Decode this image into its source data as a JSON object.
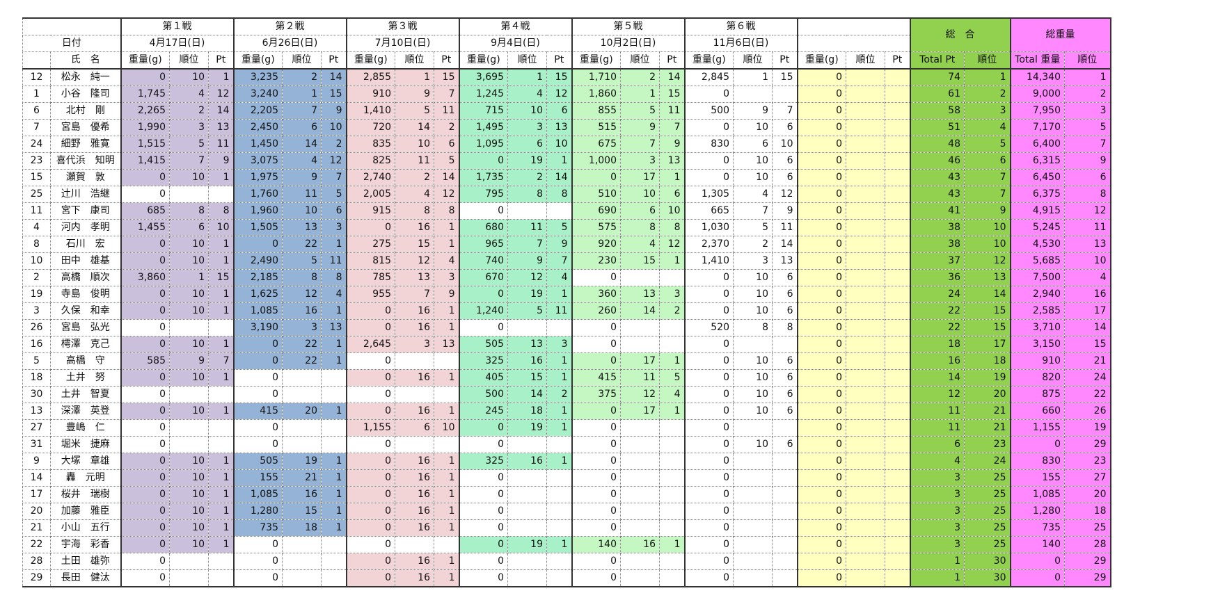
{
  "header": {
    "date_label": "日付",
    "name_label": "氏　名",
    "rounds": [
      {
        "title": "第１戦",
        "date": "4月17日(日)"
      },
      {
        "title": "第２戦",
        "date": "6月26日(日)"
      },
      {
        "title": "第３戦",
        "date": "7月10日(日)"
      },
      {
        "title": "第４戦",
        "date": "9月4日(日)"
      },
      {
        "title": "第５戦",
        "date": "10月2日(日)"
      },
      {
        "title": "第６戦",
        "date": "11月6日(日)"
      },
      {
        "title": "",
        "date": ""
      }
    ],
    "sub": {
      "weight": "重量(g)",
      "rank": "順位",
      "pt": "Pt"
    },
    "total": {
      "title": "総　合",
      "pt": "Total Pt",
      "rank": "順位"
    },
    "weight_total": {
      "title": "総重量",
      "weight": "Total 重量",
      "rank": "順位"
    }
  },
  "colors": {
    "round1": "#cbc0dc",
    "round2": "#95b3d6",
    "round3": "#f3d4d6",
    "round4": "#a8f0c8",
    "round5": "#c4f7c2",
    "round7": "#ffffc0",
    "total": "#92d050",
    "weight_total": "#ff88ff"
  },
  "rows": [
    {
      "no": "12",
      "name": "松永　純一",
      "r": [
        [
          "0",
          "10",
          "1"
        ],
        [
          "3,235",
          "2",
          "14"
        ],
        [
          "2,855",
          "1",
          "15"
        ],
        [
          "3,695",
          "1",
          "15"
        ],
        [
          "1,710",
          "2",
          "14"
        ],
        [
          "2,845",
          "1",
          "15"
        ],
        [
          "0",
          "",
          ""
        ]
      ],
      "pt": "74",
      "rank": "1",
      "w": "14,340",
      "wr": "1"
    },
    {
      "no": "1",
      "name": "小谷　隆司",
      "r": [
        [
          "1,745",
          "4",
          "12"
        ],
        [
          "3,240",
          "1",
          "15"
        ],
        [
          "910",
          "9",
          "7"
        ],
        [
          "1,245",
          "4",
          "12"
        ],
        [
          "1,860",
          "1",
          "15"
        ],
        [
          "0",
          "",
          ""
        ],
        [
          "0",
          "",
          ""
        ]
      ],
      "pt": "61",
      "rank": "2",
      "w": "9,000",
      "wr": "2"
    },
    {
      "no": "6",
      "name": "北村　剛",
      "r": [
        [
          "2,265",
          "2",
          "14"
        ],
        [
          "2,205",
          "7",
          "9"
        ],
        [
          "1,410",
          "5",
          "11"
        ],
        [
          "715",
          "10",
          "6"
        ],
        [
          "855",
          "5",
          "11"
        ],
        [
          "500",
          "9",
          "7"
        ],
        [
          "0",
          "",
          ""
        ]
      ],
      "pt": "58",
      "rank": "3",
      "w": "7,950",
      "wr": "3"
    },
    {
      "no": "7",
      "name": "宮島　優希",
      "r": [
        [
          "1,990",
          "3",
          "13"
        ],
        [
          "2,450",
          "6",
          "10"
        ],
        [
          "720",
          "14",
          "2"
        ],
        [
          "1,495",
          "3",
          "13"
        ],
        [
          "515",
          "9",
          "7"
        ],
        [
          "0",
          "10",
          "6"
        ],
        [
          "0",
          "",
          ""
        ]
      ],
      "pt": "51",
      "rank": "4",
      "w": "7,170",
      "wr": "5"
    },
    {
      "no": "24",
      "name": "細野　雅寛",
      "r": [
        [
          "1,515",
          "5",
          "11"
        ],
        [
          "1,450",
          "14",
          "2"
        ],
        [
          "835",
          "10",
          "6"
        ],
        [
          "1,095",
          "6",
          "10"
        ],
        [
          "675",
          "7",
          "9"
        ],
        [
          "830",
          "6",
          "10"
        ],
        [
          "0",
          "",
          ""
        ]
      ],
      "pt": "48",
      "rank": "5",
      "w": "6,400",
      "wr": "7"
    },
    {
      "no": "23",
      "name": "喜代浜　知明",
      "r": [
        [
          "1,415",
          "7",
          "9"
        ],
        [
          "3,075",
          "4",
          "12"
        ],
        [
          "825",
          "11",
          "5"
        ],
        [
          "0",
          "19",
          "1"
        ],
        [
          "1,000",
          "3",
          "13"
        ],
        [
          "0",
          "10",
          "6"
        ],
        [
          "0",
          "",
          ""
        ]
      ],
      "pt": "46",
      "rank": "6",
      "w": "6,315",
      "wr": "9"
    },
    {
      "no": "15",
      "name": "瀬賀　敦",
      "r": [
        [
          "0",
          "10",
          "1"
        ],
        [
          "1,975",
          "9",
          "7"
        ],
        [
          "2,740",
          "2",
          "14"
        ],
        [
          "1,735",
          "2",
          "14"
        ],
        [
          "0",
          "17",
          "1"
        ],
        [
          "0",
          "10",
          "6"
        ],
        [
          "0",
          "",
          ""
        ]
      ],
      "pt": "43",
      "rank": "7",
      "w": "6,450",
      "wr": "6"
    },
    {
      "no": "25",
      "name": "辻川　浩継",
      "r": [
        [
          "0",
          "",
          ""
        ],
        [
          "1,760",
          "11",
          "5"
        ],
        [
          "2,005",
          "4",
          "12"
        ],
        [
          "795",
          "8",
          "8"
        ],
        [
          "510",
          "10",
          "6"
        ],
        [
          "1,305",
          "4",
          "12"
        ],
        [
          "0",
          "",
          ""
        ]
      ],
      "pt": "43",
      "rank": "7",
      "w": "6,375",
      "wr": "8"
    },
    {
      "no": "11",
      "name": "宮下　康司",
      "r": [
        [
          "685",
          "8",
          "8"
        ],
        [
          "1,960",
          "10",
          "6"
        ],
        [
          "915",
          "8",
          "8"
        ],
        [
          "0",
          "",
          ""
        ],
        [
          "690",
          "6",
          "10"
        ],
        [
          "665",
          "7",
          "9"
        ],
        [
          "0",
          "",
          ""
        ]
      ],
      "pt": "41",
      "rank": "9",
      "w": "4,915",
      "wr": "12"
    },
    {
      "no": "4",
      "name": "河内　孝明",
      "r": [
        [
          "1,455",
          "6",
          "10"
        ],
        [
          "1,505",
          "13",
          "3"
        ],
        [
          "0",
          "16",
          "1"
        ],
        [
          "680",
          "11",
          "5"
        ],
        [
          "575",
          "8",
          "8"
        ],
        [
          "1,030",
          "5",
          "11"
        ],
        [
          "0",
          "",
          ""
        ]
      ],
      "pt": "38",
      "rank": "10",
      "w": "5,245",
      "wr": "11"
    },
    {
      "no": "8",
      "name": "石川　宏",
      "r": [
        [
          "0",
          "10",
          "1"
        ],
        [
          "0",
          "22",
          "1"
        ],
        [
          "275",
          "15",
          "1"
        ],
        [
          "965",
          "7",
          "9"
        ],
        [
          "920",
          "4",
          "12"
        ],
        [
          "2,370",
          "2",
          "14"
        ],
        [
          "0",
          "",
          ""
        ]
      ],
      "pt": "38",
      "rank": "10",
      "w": "4,530",
      "wr": "13"
    },
    {
      "no": "10",
      "name": "田中　雄基",
      "r": [
        [
          "0",
          "10",
          "1"
        ],
        [
          "2,490",
          "5",
          "11"
        ],
        [
          "815",
          "12",
          "4"
        ],
        [
          "740",
          "9",
          "7"
        ],
        [
          "230",
          "15",
          "1"
        ],
        [
          "1,410",
          "3",
          "13"
        ],
        [
          "0",
          "",
          ""
        ]
      ],
      "pt": "37",
      "rank": "12",
      "w": "5,685",
      "wr": "10"
    },
    {
      "no": "2",
      "name": "高橋　順次",
      "r": [
        [
          "3,860",
          "1",
          "15"
        ],
        [
          "2,185",
          "8",
          "8"
        ],
        [
          "785",
          "13",
          "3"
        ],
        [
          "670",
          "12",
          "4"
        ],
        [
          "0",
          "",
          ""
        ],
        [
          "0",
          "10",
          "6"
        ],
        [
          "0",
          "",
          ""
        ]
      ],
      "pt": "36",
      "rank": "13",
      "w": "7,500",
      "wr": "4"
    },
    {
      "no": "19",
      "name": "寺島　俊明",
      "r": [
        [
          "0",
          "10",
          "1"
        ],
        [
          "1,625",
          "12",
          "4"
        ],
        [
          "955",
          "7",
          "9"
        ],
        [
          "0",
          "19",
          "1"
        ],
        [
          "360",
          "13",
          "3"
        ],
        [
          "0",
          "10",
          "6"
        ],
        [
          "0",
          "",
          ""
        ]
      ],
      "pt": "24",
      "rank": "14",
      "w": "2,940",
      "wr": "16"
    },
    {
      "no": "3",
      "name": "久保　和幸",
      "r": [
        [
          "0",
          "10",
          "1"
        ],
        [
          "1,085",
          "16",
          "1"
        ],
        [
          "0",
          "16",
          "1"
        ],
        [
          "1,240",
          "5",
          "11"
        ],
        [
          "260",
          "14",
          "2"
        ],
        [
          "0",
          "10",
          "6"
        ],
        [
          "0",
          "",
          ""
        ]
      ],
      "pt": "22",
      "rank": "15",
      "w": "2,585",
      "wr": "17"
    },
    {
      "no": "26",
      "name": "宮島　弘光",
      "r": [
        [
          "0",
          "",
          ""
        ],
        [
          "3,190",
          "3",
          "13"
        ],
        [
          "0",
          "16",
          "1"
        ],
        [
          "0",
          "",
          ""
        ],
        [
          "0",
          "",
          ""
        ],
        [
          "520",
          "8",
          "8"
        ],
        [
          "0",
          "",
          ""
        ]
      ],
      "pt": "22",
      "rank": "15",
      "w": "3,710",
      "wr": "14"
    },
    {
      "no": "16",
      "name": "樗澤　克己",
      "r": [
        [
          "0",
          "10",
          "1"
        ],
        [
          "0",
          "22",
          "1"
        ],
        [
          "2,645",
          "3",
          "13"
        ],
        [
          "505",
          "13",
          "3"
        ],
        [
          "0",
          "",
          ""
        ],
        [
          "0",
          "",
          ""
        ],
        [
          "0",
          "",
          ""
        ]
      ],
      "pt": "18",
      "rank": "17",
      "w": "3,150",
      "wr": "15"
    },
    {
      "no": "5",
      "name": "高橋　守",
      "r": [
        [
          "585",
          "9",
          "7"
        ],
        [
          "0",
          "22",
          "1"
        ],
        [
          "0",
          "",
          ""
        ],
        [
          "325",
          "16",
          "1"
        ],
        [
          "0",
          "17",
          "1"
        ],
        [
          "0",
          "10",
          "6"
        ],
        [
          "0",
          "",
          ""
        ]
      ],
      "pt": "16",
      "rank": "18",
      "w": "910",
      "wr": "21"
    },
    {
      "no": "18",
      "name": "土井　努",
      "r": [
        [
          "0",
          "10",
          "1"
        ],
        [
          "0",
          "",
          ""
        ],
        [
          "0",
          "16",
          "1"
        ],
        [
          "405",
          "15",
          "1"
        ],
        [
          "415",
          "11",
          "5"
        ],
        [
          "0",
          "10",
          "6"
        ],
        [
          "0",
          "",
          ""
        ]
      ],
      "pt": "14",
      "rank": "19",
      "w": "820",
      "wr": "24"
    },
    {
      "no": "30",
      "name": "土井　智夏",
      "r": [
        [
          "0",
          "",
          ""
        ],
        [
          "0",
          "",
          ""
        ],
        [
          "0",
          "",
          ""
        ],
        [
          "500",
          "14",
          "2"
        ],
        [
          "375",
          "12",
          "4"
        ],
        [
          "0",
          "10",
          "6"
        ],
        [
          "0",
          "",
          ""
        ]
      ],
      "pt": "12",
      "rank": "20",
      "w": "875",
      "wr": "22"
    },
    {
      "no": "13",
      "name": "深澤　英登",
      "r": [
        [
          "0",
          "10",
          "1"
        ],
        [
          "415",
          "20",
          "1"
        ],
        [
          "0",
          "16",
          "1"
        ],
        [
          "245",
          "18",
          "1"
        ],
        [
          "0",
          "17",
          "1"
        ],
        [
          "0",
          "10",
          "6"
        ],
        [
          "0",
          "",
          ""
        ]
      ],
      "pt": "11",
      "rank": "21",
      "w": "660",
      "wr": "26"
    },
    {
      "no": "27",
      "name": "豊嶋　仁",
      "r": [
        [
          "0",
          "",
          ""
        ],
        [
          "0",
          "",
          ""
        ],
        [
          "1,155",
          "6",
          "10"
        ],
        [
          "0",
          "19",
          "1"
        ],
        [
          "0",
          "",
          ""
        ],
        [
          "0",
          "",
          ""
        ],
        [
          "0",
          "",
          ""
        ]
      ],
      "pt": "11",
      "rank": "21",
      "w": "1,155",
      "wr": "19"
    },
    {
      "no": "31",
      "name": "堀米　捷麻",
      "r": [
        [
          "0",
          "",
          ""
        ],
        [
          "0",
          "",
          ""
        ],
        [
          "0",
          "",
          ""
        ],
        [
          "0",
          "",
          ""
        ],
        [
          "0",
          "",
          ""
        ],
        [
          "0",
          "10",
          "6"
        ],
        [
          "0",
          "",
          ""
        ]
      ],
      "pt": "6",
      "rank": "23",
      "w": "0",
      "wr": "29"
    },
    {
      "no": "9",
      "name": "大塚　章雄",
      "r": [
        [
          "0",
          "10",
          "1"
        ],
        [
          "505",
          "19",
          "1"
        ],
        [
          "0",
          "16",
          "1"
        ],
        [
          "325",
          "16",
          "1"
        ],
        [
          "0",
          "",
          ""
        ],
        [
          "0",
          "",
          ""
        ],
        [
          "0",
          "",
          ""
        ]
      ],
      "pt": "4",
      "rank": "24",
      "w": "830",
      "wr": "23"
    },
    {
      "no": "14",
      "name": "轟　元明",
      "r": [
        [
          "0",
          "10",
          "1"
        ],
        [
          "155",
          "21",
          "1"
        ],
        [
          "0",
          "16",
          "1"
        ],
        [
          "0",
          "",
          ""
        ],
        [
          "0",
          "",
          ""
        ],
        [
          "0",
          "",
          ""
        ],
        [
          "0",
          "",
          ""
        ]
      ],
      "pt": "3",
      "rank": "25",
      "w": "155",
      "wr": "27"
    },
    {
      "no": "17",
      "name": "桜井　瑞樹",
      "r": [
        [
          "0",
          "10",
          "1"
        ],
        [
          "1,085",
          "16",
          "1"
        ],
        [
          "0",
          "16",
          "1"
        ],
        [
          "0",
          "",
          ""
        ],
        [
          "0",
          "",
          ""
        ],
        [
          "0",
          "",
          ""
        ],
        [
          "0",
          "",
          ""
        ]
      ],
      "pt": "3",
      "rank": "25",
      "w": "1,085",
      "wr": "20"
    },
    {
      "no": "20",
      "name": "加藤　雅臣",
      "r": [
        [
          "0",
          "10",
          "1"
        ],
        [
          "1,280",
          "15",
          "1"
        ],
        [
          "0",
          "16",
          "1"
        ],
        [
          "0",
          "",
          ""
        ],
        [
          "0",
          "",
          ""
        ],
        [
          "0",
          "",
          ""
        ],
        [
          "0",
          "",
          ""
        ]
      ],
      "pt": "3",
      "rank": "25",
      "w": "1,280",
      "wr": "18"
    },
    {
      "no": "21",
      "name": "小山　五行",
      "r": [
        [
          "0",
          "10",
          "1"
        ],
        [
          "735",
          "18",
          "1"
        ],
        [
          "0",
          "16",
          "1"
        ],
        [
          "0",
          "",
          ""
        ],
        [
          "0",
          "",
          ""
        ],
        [
          "0",
          "",
          ""
        ],
        [
          "0",
          "",
          ""
        ]
      ],
      "pt": "3",
      "rank": "25",
      "w": "735",
      "wr": "25"
    },
    {
      "no": "22",
      "name": "宇海　彩香",
      "r": [
        [
          "0",
          "10",
          "1"
        ],
        [
          "0",
          "",
          ""
        ],
        [
          "0",
          "",
          ""
        ],
        [
          "0",
          "19",
          "1"
        ],
        [
          "140",
          "16",
          "1"
        ],
        [
          "0",
          "",
          ""
        ],
        [
          "0",
          "",
          ""
        ]
      ],
      "pt": "3",
      "rank": "25",
      "w": "140",
      "wr": "28"
    },
    {
      "no": "28",
      "name": "土田　雄弥",
      "r": [
        [
          "0",
          "",
          ""
        ],
        [
          "0",
          "",
          ""
        ],
        [
          "0",
          "16",
          "1"
        ],
        [
          "0",
          "",
          ""
        ],
        [
          "0",
          "",
          ""
        ],
        [
          "0",
          "",
          ""
        ],
        [
          "0",
          "",
          ""
        ]
      ],
      "pt": "1",
      "rank": "30",
      "w": "0",
      "wr": "29"
    },
    {
      "no": "29",
      "name": "長田　健汰",
      "r": [
        [
          "0",
          "",
          ""
        ],
        [
          "0",
          "",
          ""
        ],
        [
          "0",
          "16",
          "1"
        ],
        [
          "0",
          "",
          ""
        ],
        [
          "0",
          "",
          ""
        ],
        [
          "0",
          "",
          ""
        ],
        [
          "0",
          "",
          ""
        ]
      ],
      "pt": "1",
      "rank": "30",
      "w": "0",
      "wr": "29"
    }
  ]
}
